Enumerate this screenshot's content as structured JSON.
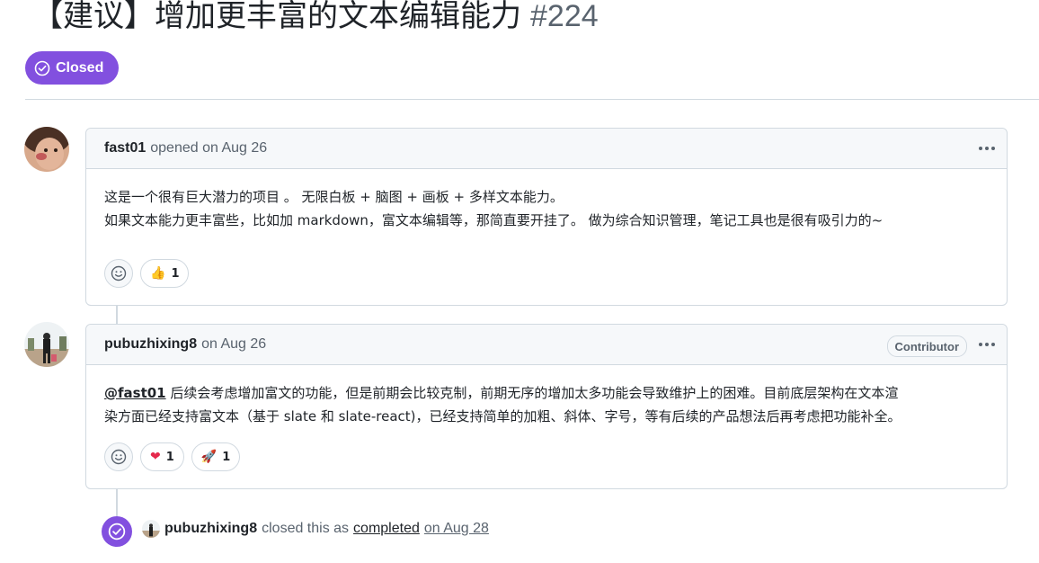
{
  "issue": {
    "title": "【建议】增加更丰富的文本编辑能力",
    "number": "#224",
    "status": "Closed"
  },
  "comments": [
    {
      "author": "fast01",
      "meta": "opened on Aug 26",
      "body_line1": "这是一个很有巨大潜力的项目 。 无限白板 + 脑图 + 画板 + 多样文本能力。",
      "body_line2": "如果文本能力更丰富些，比如加 markdown，富文本编辑等，那简直要开挂了。 做为综合知识管理，笔记工具也是很有吸引力的~",
      "reactions": [
        {
          "icon": "thumbs-up-emoji",
          "glyph": "👍",
          "count": "1"
        }
      ]
    },
    {
      "author": "pubuzhixing8",
      "meta": "on Aug 26",
      "role": "Contributor",
      "mention": "@fast01",
      "body_line1": " 后续会考虑增加富文的功能，但是前期会比较克制，前期无序的增加太多功能会导致维护上的困难。目前底层架构在文本渲",
      "body_line2": "染方面已经支持富文本（基于 slate 和 slate-react)，已经支持简单的加粗、斜体、字号，等有后续的产品想法后再考虑把功能补全。",
      "reactions": [
        {
          "icon": "heart-emoji",
          "glyph": "❤",
          "count": "1"
        },
        {
          "icon": "rocket-emoji",
          "glyph": "🚀",
          "count": "1"
        }
      ]
    }
  ],
  "event": {
    "author": "pubuzhixing8",
    "action": "closed this as",
    "state": "completed",
    "date": "on Aug 28"
  },
  "colors": {
    "closed_purple": "#8250df",
    "border": "#d1d9e0",
    "header_bg": "#f6f8fa",
    "muted": "#59636e"
  }
}
